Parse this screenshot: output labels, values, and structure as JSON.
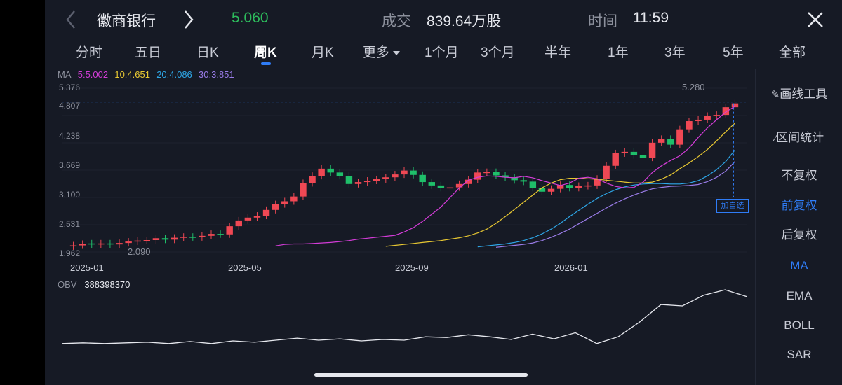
{
  "header": {
    "stock_name": "徽商银行",
    "price": "5.060",
    "volume_label": "成交",
    "volume_value": "839.64万股",
    "time_label": "时间",
    "time_value": "11:59"
  },
  "period_tabs": [
    "分时",
    "五日",
    "日K",
    "周K",
    "月K",
    "更多",
    "1个月",
    "3个月",
    "半年",
    "1年",
    "3年",
    "5年",
    "全部"
  ],
  "active_tab": "周K",
  "ma": {
    "label": "MA",
    "ma5": "5:5.002",
    "ma10": "10:4.651",
    "ma20": "20:4.086",
    "ma30": "30:3.851"
  },
  "y_axis": [
    "5.376",
    "4.807",
    "4.238",
    "3.669",
    "3.100",
    "2.531",
    "1.962"
  ],
  "x_axis": [
    "2025-01",
    "2025-05",
    "2025-09",
    "2026-01"
  ],
  "price_marks": {
    "high": "5.280",
    "low": "2.090"
  },
  "add_watchlist": "加自选",
  "obv": {
    "label": "OBV",
    "value": "388398370"
  },
  "side_menu": {
    "draw_tool": "画线工具",
    "range_stats": "区间统计",
    "no_adjust": "不复权",
    "forward_adjust": "前复权",
    "backward_adjust": "后复权",
    "ma": "MA",
    "ema": "EMA",
    "boll": "BOLL",
    "sar": "SAR"
  },
  "colors": {
    "up": "#f04854",
    "down": "#1fbf6a",
    "ma5": "#d43cd8",
    "ma10": "#e8c832",
    "ma20": "#2ea6e6",
    "ma30": "#9a7ce8",
    "accent": "#2f7cf6"
  },
  "chart_data": {
    "type": "candlestick",
    "closes": [
      2.1,
      2.13,
      2.12,
      2.14,
      2.12,
      2.15,
      2.18,
      2.2,
      2.21,
      2.25,
      2.22,
      2.26,
      2.28,
      2.27,
      2.3,
      2.34,
      2.33,
      2.5,
      2.62,
      2.68,
      2.72,
      2.84,
      2.96,
      3.02,
      3.12,
      3.4,
      3.55,
      3.7,
      3.62,
      3.55,
      3.38,
      3.42,
      3.45,
      3.48,
      3.52,
      3.58,
      3.66,
      3.57,
      3.42,
      3.35,
      3.3,
      3.31,
      3.38,
      3.47,
      3.62,
      3.63,
      3.56,
      3.52,
      3.46,
      3.43,
      3.3,
      3.22,
      3.28,
      3.36,
      3.3,
      3.34,
      3.35,
      3.49,
      3.76,
      4.02,
      4.05,
      3.98,
      3.93,
      4.24,
      4.32,
      4.2,
      4.52,
      4.69,
      4.72,
      4.8,
      4.82,
      4.98,
      5.06
    ],
    "opens": [
      2.08,
      2.1,
      2.14,
      2.12,
      2.14,
      2.12,
      2.15,
      2.18,
      2.2,
      2.21,
      2.25,
      2.22,
      2.26,
      2.28,
      2.27,
      2.3,
      2.34,
      2.33,
      2.5,
      2.62,
      2.68,
      2.72,
      2.84,
      2.96,
      3.02,
      3.12,
      3.4,
      3.55,
      3.7,
      3.62,
      3.55,
      3.38,
      3.42,
      3.45,
      3.48,
      3.52,
      3.58,
      3.66,
      3.57,
      3.42,
      3.35,
      3.3,
      3.31,
      3.38,
      3.47,
      3.62,
      3.63,
      3.56,
      3.52,
      3.46,
      3.43,
      3.3,
      3.22,
      3.28,
      3.36,
      3.3,
      3.34,
      3.35,
      3.49,
      3.76,
      4.02,
      4.05,
      3.98,
      3.93,
      4.24,
      4.32,
      4.2,
      4.52,
      4.69,
      4.72,
      4.8,
      4.82,
      4.98
    ],
    "ma5": [
      2.09,
      2.12,
      2.13,
      2.13,
      2.14,
      2.15,
      2.16,
      2.18,
      2.2,
      2.23,
      2.25,
      2.27,
      2.29,
      2.31,
      2.38,
      2.47,
      2.6,
      2.75,
      2.9,
      3.1,
      3.3,
      3.46,
      3.52,
      3.55,
      3.54,
      3.52,
      3.51,
      3.54,
      3.51,
      3.45,
      3.4,
      3.35,
      3.4,
      3.5,
      3.52,
      3.49,
      3.4,
      3.33,
      3.3,
      3.31,
      3.42,
      3.62,
      3.76,
      3.87,
      3.97,
      4.13,
      4.35,
      4.55,
      4.72,
      4.88,
      5.0
    ],
    "ma10": [
      2.08,
      2.1,
      2.12,
      2.14,
      2.16,
      2.18,
      2.2,
      2.23,
      2.26,
      2.3,
      2.36,
      2.44,
      2.56,
      2.7,
      2.85,
      3.0,
      3.15,
      3.3,
      3.4,
      3.47,
      3.5,
      3.5,
      3.49,
      3.48,
      3.46,
      3.44,
      3.42,
      3.4,
      3.4,
      3.42,
      3.48,
      3.57,
      3.7,
      3.82,
      3.95,
      4.1,
      4.28,
      4.47,
      4.65
    ],
    "ma20": [
      2.07,
      2.09,
      2.11,
      2.13,
      2.16,
      2.2,
      2.26,
      2.34,
      2.44,
      2.56,
      2.7,
      2.83,
      2.96,
      3.08,
      3.18,
      3.26,
      3.32,
      3.36,
      3.38,
      3.39,
      3.39,
      3.38,
      3.38,
      3.4,
      3.45,
      3.55,
      3.68,
      3.85,
      4.09
    ],
    "ma30": [
      2.06,
      2.08,
      2.1,
      2.12,
      2.15,
      2.2,
      2.27,
      2.35,
      2.44,
      2.55,
      2.66,
      2.77,
      2.88,
      2.98,
      3.07,
      3.15,
      3.22,
      3.28,
      3.31,
      3.33,
      3.34,
      3.35,
      3.37,
      3.43,
      3.52,
      3.65,
      3.85
    ],
    "obv_series": [
      0.2,
      0.21,
      0.2,
      0.21,
      0.22,
      0.2,
      0.23,
      0.2,
      0.24,
      0.22,
      0.25,
      0.28,
      0.25,
      0.27,
      0.24,
      0.26,
      0.25,
      0.3,
      0.29,
      0.33,
      0.3,
      0.26,
      0.34,
      0.27,
      0.36,
      0.2,
      0.3,
      0.52,
      0.78,
      0.76,
      0.92,
      1.0,
      0.9
    ],
    "ylim": [
      1.962,
      5.376
    ]
  }
}
